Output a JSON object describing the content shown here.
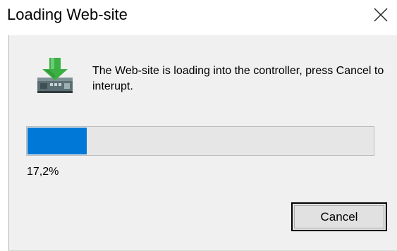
{
  "dialog": {
    "title": "Loading Web-site",
    "message": "The Web-site is loading into the controller, press Cancel to interupt.",
    "progress": {
      "fraction": 0.172,
      "label": "17,2%"
    },
    "cancel_label": "Cancel",
    "icons": {
      "close": "close-icon",
      "main": "download-controller-icon"
    }
  },
  "colors": {
    "progress_fill": "#0078d7",
    "progress_track": "#e6e6e6",
    "client_bg": "#f0f0f0",
    "icon_arrow": "#3cb043"
  }
}
